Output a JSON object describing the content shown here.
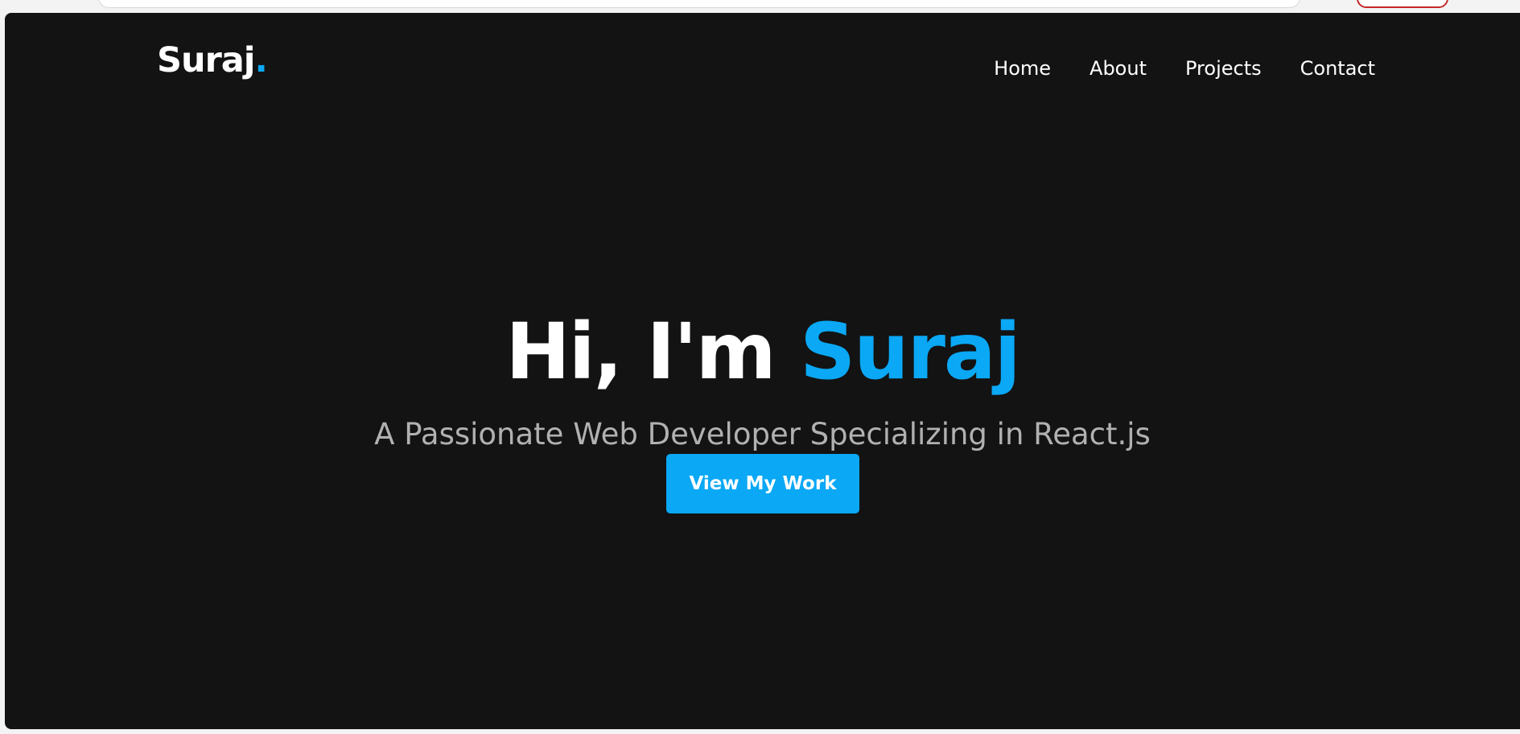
{
  "header": {
    "brand_name": "Suraj",
    "brand_dot": "."
  },
  "nav": {
    "items": [
      {
        "label": "Home"
      },
      {
        "label": "About"
      },
      {
        "label": "Projects"
      },
      {
        "label": "Contact"
      }
    ]
  },
  "hero": {
    "greeting": "Hi, I'm ",
    "name": "Suraj",
    "subtitle": "A Passionate Web Developer Specializing in React.js",
    "cta_label": "View My Work"
  },
  "colors": {
    "background": "#131313",
    "accent": "#0aa8f5",
    "text": "#ffffff",
    "muted_text": "#b1b1b1"
  }
}
